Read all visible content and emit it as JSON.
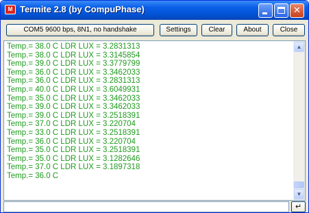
{
  "window": {
    "title": "Termite 2.8 (by CompuPhase)",
    "icon_text": "M",
    "controls": {
      "minimize": "",
      "maximize": "",
      "close": "✕"
    }
  },
  "toolbar": {
    "port_status": "COM5 9600 bps, 8N1, no handshake",
    "settings_label": "Settings",
    "clear_label": "Clear",
    "about_label": "About",
    "close_label": "Close"
  },
  "output": {
    "lines": [
      "Temp.= 38.0 C LDR LUX = 3.2831313",
      "Temp.= 38.0 C LDR LUX = 3.3145854",
      "Temp.= 39.0 C LDR LUX = 3.3779799",
      "Temp.= 36.0 C LDR LUX = 3.3462033",
      "Temp.= 36.0 C LDR LUX = 3.2831313",
      "Temp.= 40.0 C LDR LUX = 3.6049931",
      "Temp.= 35.0 C LDR LUX = 3.3462033",
      "Temp.= 39.0 C LDR LUX = 3.3462033",
      "Temp.= 39.0 C LDR LUX = 3.2518391",
      "Temp.= 37.0 C LDR LUX = 3.220704",
      "Temp.= 33.0 C LDR LUX = 3.2518391",
      "Temp.= 36.0 C LDR LUX = 3.220704",
      "Temp.= 35.0 C LDR LUX = 3.2518391",
      "Temp.= 35.0 C LDR LUX = 3.1282646",
      "Temp.= 37.0 C LDR LUX = 3.1897318",
      "Temp.= 36.0 C"
    ],
    "text_color": "#1f9a1f",
    "scroll_up_icon": "▲",
    "scroll_down_icon": "▼"
  },
  "input": {
    "value": "",
    "send_icon": "↵"
  }
}
